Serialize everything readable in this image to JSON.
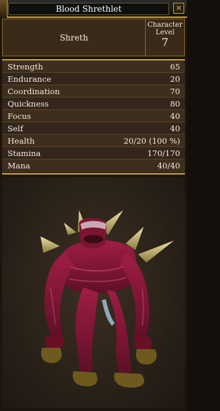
{
  "window": {
    "title": "Blood Shrethlet",
    "close_symbol": "×"
  },
  "header": {
    "creature_type": "Shreth",
    "level_label_line1": "Character",
    "level_label_line2": "Level",
    "level_value": "7"
  },
  "stats": [
    {
      "label": "Strength",
      "value": "65"
    },
    {
      "label": "Endurance",
      "value": "20"
    },
    {
      "label": "Coordination",
      "value": "70"
    },
    {
      "label": "Quickness",
      "value": "80"
    },
    {
      "label": "Focus",
      "value": "40"
    },
    {
      "label": "Self",
      "value": "40"
    },
    {
      "label": "Health",
      "value": "20/20 (100 %)"
    },
    {
      "label": "Stamina",
      "value": "170/170"
    },
    {
      "label": "Mana",
      "value": "40/40"
    }
  ],
  "colors": {
    "gold_border": "#c9a040",
    "creature_body": "#8a1836",
    "creature_spikes": "#d8c88a"
  },
  "portrait": {
    "subject": "blood-shrethlet-creature"
  }
}
